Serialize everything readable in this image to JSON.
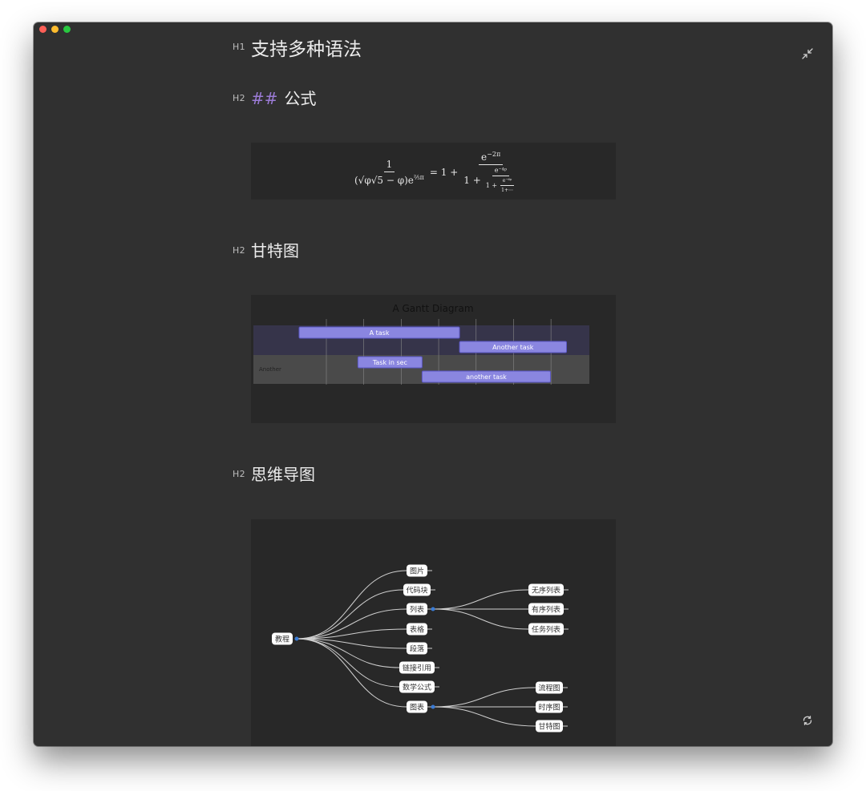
{
  "document": {
    "h1_tag": "H1",
    "h1_title": "支持多种语法",
    "sections": [
      {
        "tag": "H2",
        "hash": "##",
        "title": "公式"
      },
      {
        "tag": "H2",
        "title": "甘特图"
      },
      {
        "tag": "H2",
        "title": "思维导图"
      }
    ]
  },
  "math": {
    "lhs_num": "1",
    "lhs_den_left": "(√φ√5 − φ)e",
    "lhs_den_exp": "⅖π",
    "equals": "= 1 +",
    "rhs_num": "e",
    "rhs_num_exp": "−2π",
    "rhs_den": "1 +",
    "rhs_den_num": "e⁻⁴ᵖ",
    "rhs_den_den": "1 +",
    "rhs_deep_num": "e⁻⁶ᵖ",
    "rhs_deep_den": "1+⋯"
  },
  "gantt": {
    "title": "A Gantt Diagram",
    "section_label": "Another",
    "tasks": [
      {
        "label": "A task",
        "start": 0,
        "end": 30
      },
      {
        "label": "Another task",
        "start": 30,
        "end": 50
      },
      {
        "label": "Task in sec",
        "start": 11,
        "end": 23
      },
      {
        "label": "another task",
        "start": 23,
        "end": 47
      }
    ],
    "colors": {
      "bar": "#8a86e0",
      "bar_border": "#5b57c4",
      "section1": "#36344a",
      "section2": "#4a4a4a"
    }
  },
  "mindmap": {
    "root": "教程",
    "children": [
      "图片",
      "代码块",
      "列表",
      "表格",
      "段落",
      "链接引用",
      "数学公式",
      "图表"
    ],
    "list_children": [
      "无序列表",
      "有序列表",
      "任务列表"
    ],
    "chart_children": [
      "流程图",
      "时序图",
      "甘特图"
    ],
    "colors": {
      "node_bg": "#ffffff",
      "node_text": "#333333",
      "link": "#d0d0d0",
      "dot": "#3a7bd5"
    }
  },
  "icons": {
    "shrink": "shrink-icon",
    "sync": "sync-icon"
  }
}
